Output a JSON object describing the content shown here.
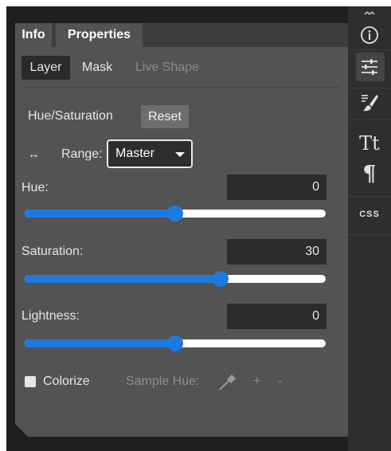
{
  "tabs": {
    "info": "Info",
    "properties": "Properties"
  },
  "subtabs": {
    "layer": "Layer",
    "mask": "Mask",
    "live_shape": "Live Shape"
  },
  "adjustment": {
    "title": "Hue/Saturation",
    "reset_label": "Reset"
  },
  "range": {
    "swap_glyph": "↔",
    "label": "Range:",
    "selected": "Master"
  },
  "hue": {
    "label": "Hue:",
    "value": "0",
    "slider_fraction": 0.5
  },
  "saturation": {
    "label": "Saturation:",
    "value": "30",
    "slider_fraction": 0.65
  },
  "lightness": {
    "label": "Lightness:",
    "value": "0",
    "slider_fraction": 0.5
  },
  "colorize": {
    "label": "Colorize",
    "checked": false
  },
  "sample_hue": {
    "label": "Sample Hue:",
    "plus": "+",
    "minus": "-"
  },
  "sidebar": {
    "icons": [
      "info-icon",
      "adjustments-icon",
      "brush-icon",
      "character-icon",
      "paragraph-icon",
      "css-icon"
    ],
    "character_glyph": "Tt",
    "paragraph_glyph": "¶",
    "css_label": "CSS"
  },
  "colors": {
    "accent": "#1f7ae0",
    "panel": "#535353",
    "background": "#1f1f1f"
  }
}
